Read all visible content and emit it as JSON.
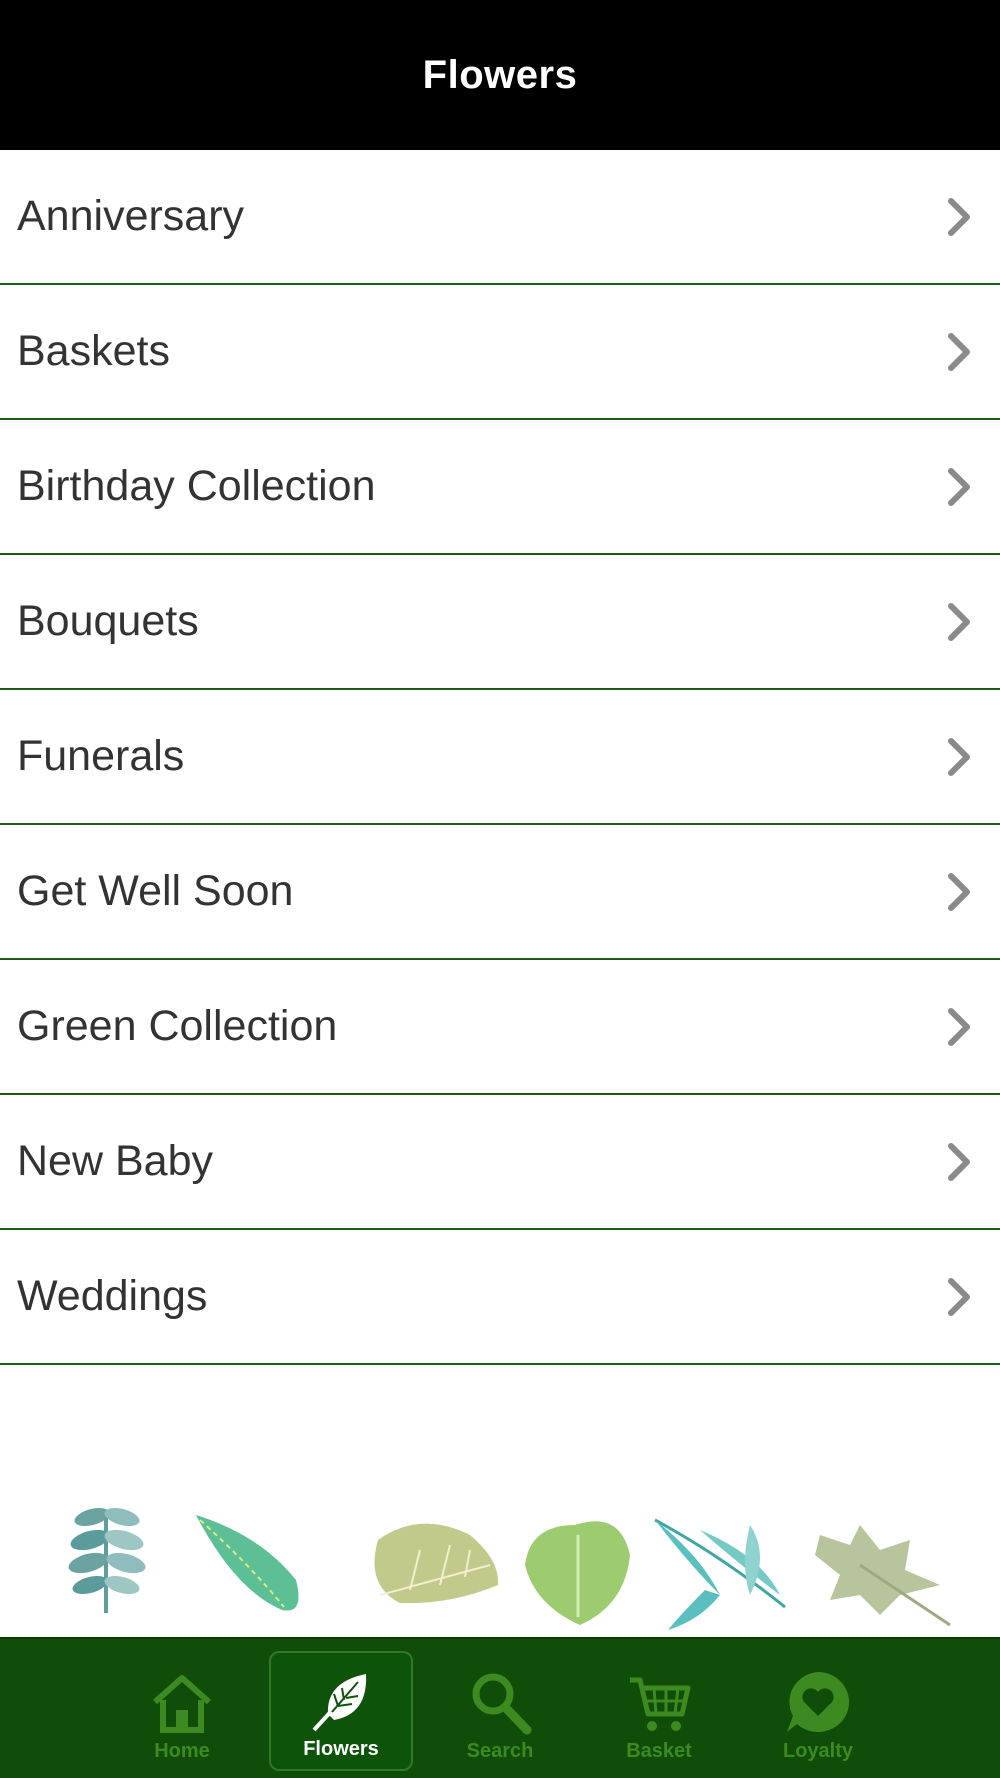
{
  "header": {
    "title": "Flowers"
  },
  "categories": [
    {
      "label": "Anniversary"
    },
    {
      "label": "Baskets"
    },
    {
      "label": "Birthday Collection"
    },
    {
      "label": "Bouquets"
    },
    {
      "label": "Funerals"
    },
    {
      "label": "Get Well Soon"
    },
    {
      "label": "Green Collection"
    },
    {
      "label": "New Baby"
    },
    {
      "label": "Weddings"
    }
  ],
  "tabs": [
    {
      "label": "Home",
      "icon": "home-icon"
    },
    {
      "label": "Flowers",
      "icon": "leaf-icon",
      "active": true
    },
    {
      "label": "Search",
      "icon": "search-icon"
    },
    {
      "label": "Basket",
      "icon": "cart-icon"
    },
    {
      "label": "Loyalty",
      "icon": "heart-chat-icon"
    }
  ],
  "colors": {
    "header_bg": "#000000",
    "tabbar_bg": "#0f4d09",
    "divider": "#1d5a1a",
    "tab_inactive": "#3c8a20",
    "chevron": "#8a8a8a"
  }
}
